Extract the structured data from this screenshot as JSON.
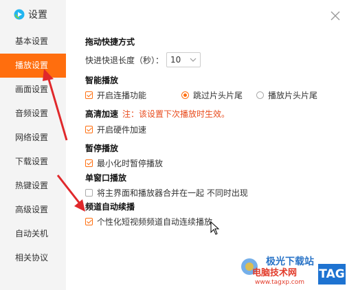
{
  "app": {
    "title": "设置",
    "logo_icon": "video-logo-icon"
  },
  "sidebar": {
    "items": [
      {
        "label": "基本设置",
        "active": false
      },
      {
        "label": "播放设置",
        "active": true
      },
      {
        "label": "画面设置",
        "active": false
      },
      {
        "label": "音频设置",
        "active": false
      },
      {
        "label": "网络设置",
        "active": false
      },
      {
        "label": "下载设置",
        "active": false
      },
      {
        "label": "热键设置",
        "active": false
      },
      {
        "label": "高级设置",
        "active": false
      },
      {
        "label": "自动关机",
        "active": false
      },
      {
        "label": "相关协议",
        "active": false
      }
    ]
  },
  "sections": {
    "drag": {
      "title": "拖动快捷方式",
      "label": "快进快退长度（秒）：",
      "value": "10"
    },
    "smart": {
      "title": "智能播放",
      "opt1": "开启连播功能",
      "opt2": "跳过片头片尾",
      "opt3": "播放片头片尾"
    },
    "hd": {
      "title": "高清加速",
      "note": "注：该设置下次播放时生效。",
      "opt": "开启硬件加速"
    },
    "pause": {
      "title": "暂停播放",
      "opt": "最小化时暂停播放"
    },
    "single": {
      "title": "单窗口播放",
      "opt": "将主界面和播放器合并在一起 不同时出现"
    },
    "channel": {
      "title": "频道自动续播",
      "opt": "个性化短视频频道自动连续播放"
    }
  },
  "watermark": {
    "line1": "极光下载站",
    "line2": "电脑技术网",
    "url": "www.tagxp.com",
    "tag": "TAG"
  },
  "colors": {
    "accent": "#ff6e0e",
    "arrow": "#e0282b",
    "note": "#e84a1b"
  }
}
